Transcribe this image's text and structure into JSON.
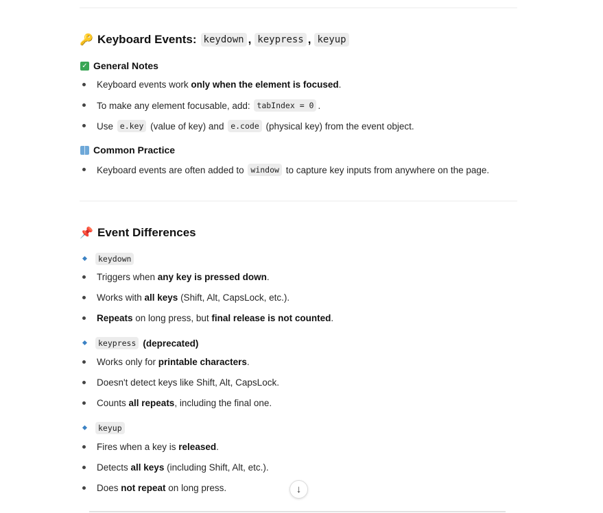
{
  "section1": {
    "title_prefix": "Keyboard Events:",
    "codes": [
      "keydown",
      "keypress",
      "keyup"
    ],
    "sep": ",",
    "icon": "key-icon"
  },
  "general": {
    "title": "General Notes",
    "items": [
      {
        "pre": "Keyboard events work ",
        "bold": "only when the element is focused",
        "post": "."
      },
      {
        "pre": "To make any element focusable, add: ",
        "code": "tabIndex = 0",
        "post": "."
      },
      {
        "pre": "Use ",
        "code1": "e.key",
        "mid": " (value of key) and ",
        "code2": "e.code",
        "post": " (physical key) from the event object."
      }
    ]
  },
  "practice": {
    "title": "Common Practice",
    "item": {
      "pre": "Keyboard events are often added to ",
      "code": "window",
      "post": " to capture key inputs from anywhere on the page."
    }
  },
  "section2": {
    "title": "Event Differences",
    "icon": "pushpin-icon"
  },
  "keydown": {
    "code": "keydown",
    "items": [
      {
        "pre": "Triggers when ",
        "bold": "any key is pressed down",
        "post": "."
      },
      {
        "pre": "Works with ",
        "bold": "all keys",
        "post": " (Shift, Alt, CapsLock, etc.)."
      },
      {
        "bold": "Repeats",
        "mid": " on long press, but ",
        "bold2": "final release is not counted",
        "post": "."
      }
    ]
  },
  "keypress": {
    "code": "keypress",
    "suffix": "(deprecated)",
    "items": [
      {
        "pre": "Works only for ",
        "bold": "printable characters",
        "post": "."
      },
      {
        "text": "Doesn't detect keys like Shift, Alt, CapsLock."
      },
      {
        "pre": "Counts ",
        "bold": "all repeats",
        "post": ", including the final one."
      }
    ]
  },
  "keyup": {
    "code": "keyup",
    "items": [
      {
        "pre": "Fires when a key is ",
        "bold": "released",
        "post": "."
      },
      {
        "pre": "Detects ",
        "bold": "all keys",
        "post": " (including Shift, Alt, etc.)."
      },
      {
        "pre": "Does ",
        "bold": "not repeat",
        "post": " on long press."
      }
    ]
  },
  "scroll_button": {
    "icon": "arrow-down-icon",
    "glyph": "↓"
  }
}
